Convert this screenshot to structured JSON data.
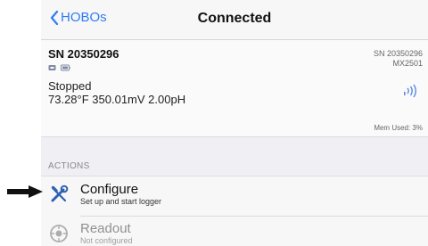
{
  "nav": {
    "back_label": "HOBOs",
    "title": "Connected"
  },
  "device": {
    "serial": "SN 20350296",
    "status": "Stopped",
    "readings": "73.28°F 350.01mV 2.00pH",
    "serial_right": "SN 20350296",
    "model": "MX2501",
    "mem_used": "Mem Used: 3%",
    "icons": [
      "sensor-icon",
      "battery-icon",
      "signal-strength-icon"
    ]
  },
  "actions": {
    "header": "ACTIONS",
    "items": [
      {
        "title": "Configure",
        "subtitle": "Set up and start logger",
        "icon": "wrench-screwdriver-icon",
        "enabled": true
      },
      {
        "title": "Readout",
        "subtitle": "Not configured",
        "icon": "readout-icon",
        "enabled": false
      }
    ]
  },
  "annotation": {
    "icon": "pointer-arrow-icon"
  }
}
